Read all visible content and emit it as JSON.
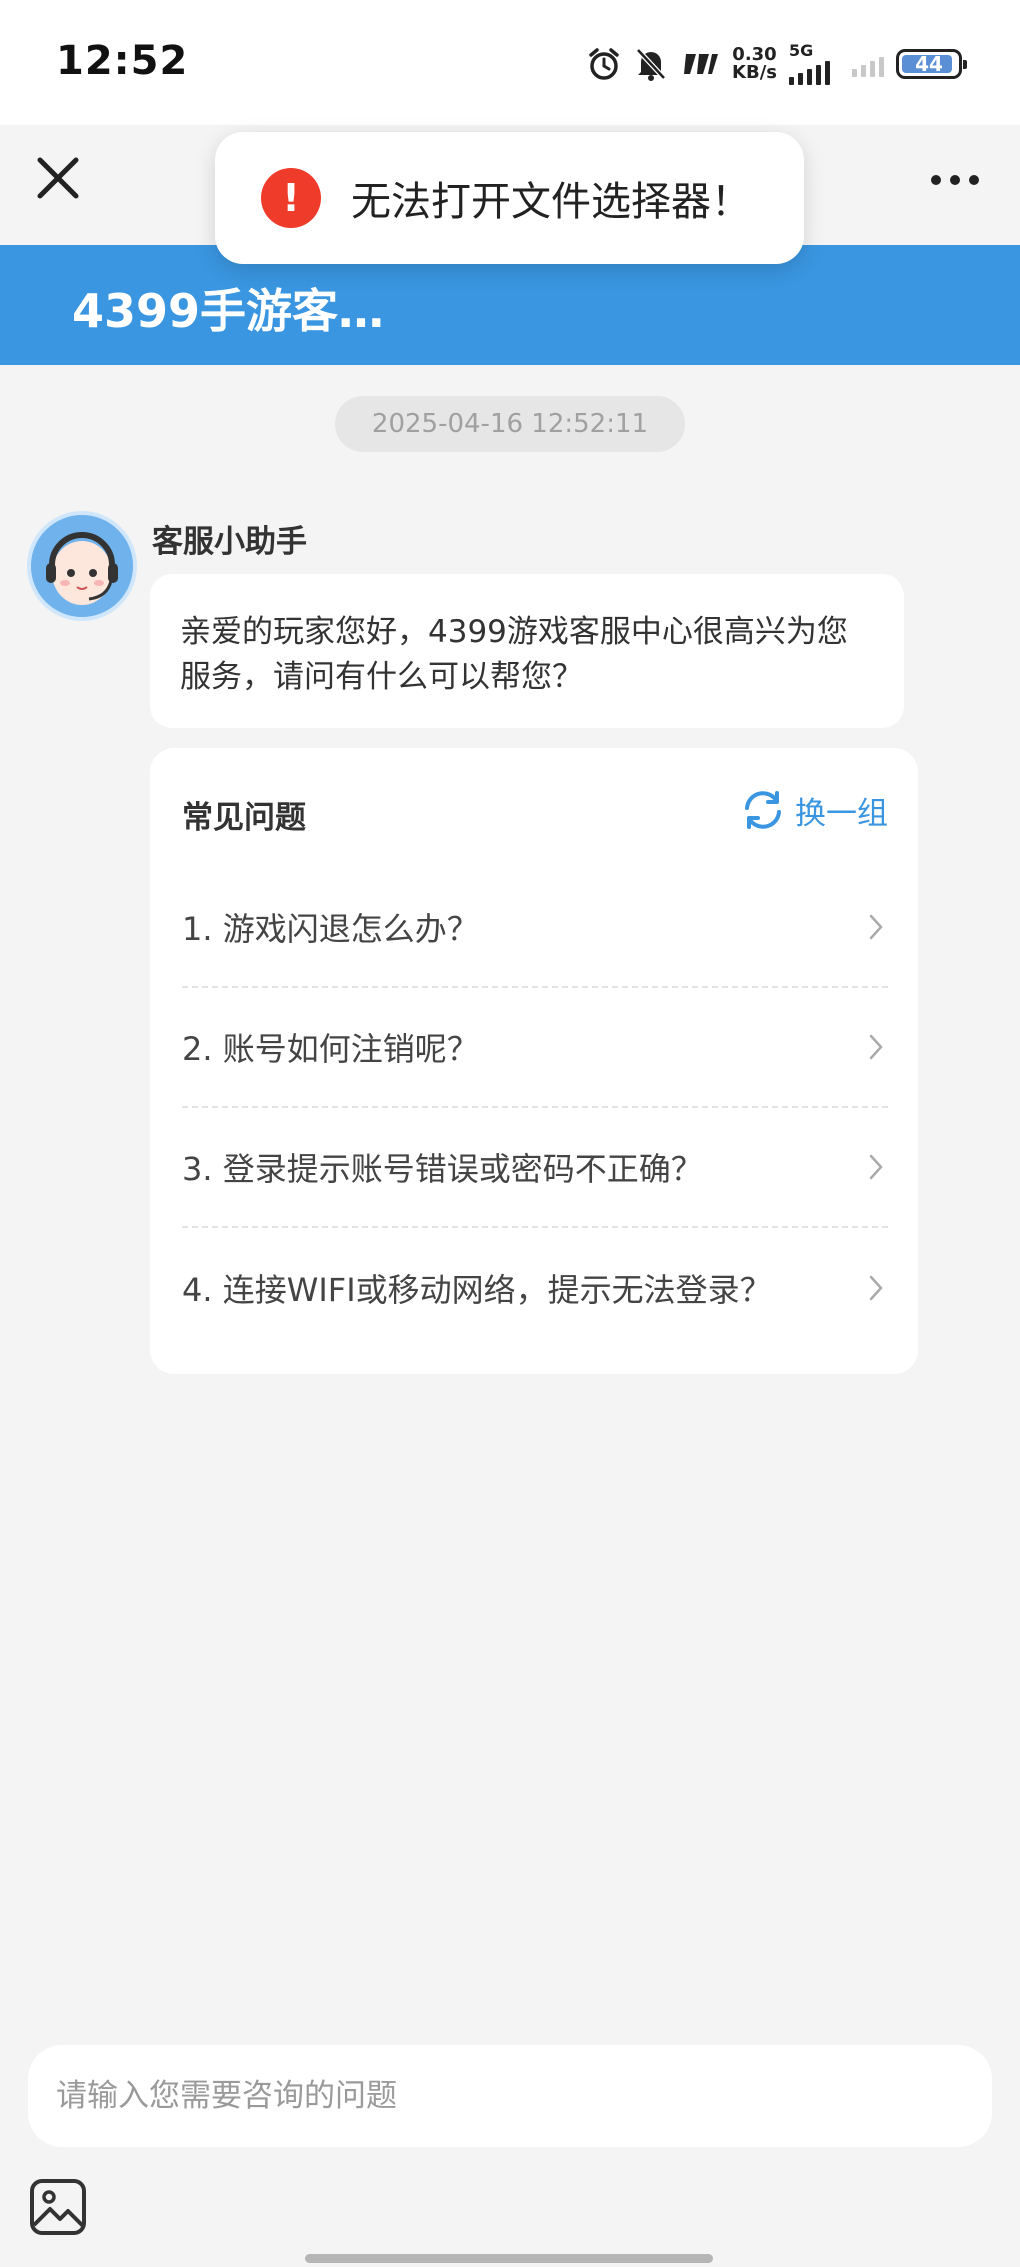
{
  "status_bar": {
    "time": "12:52",
    "net_speed_value": "0.30",
    "net_speed_unit": "KB/s",
    "network_type": "5G",
    "battery": "44",
    "icons": [
      "alarm-icon",
      "mute-icon",
      "speed-icon",
      "signal-5g-icon",
      "signal-icon",
      "battery-icon"
    ]
  },
  "nav": {
    "close_icon": "close-icon",
    "more_icon": "more-icon"
  },
  "header": {
    "title": "4399手游客…",
    "color": "#3a96e0"
  },
  "toast": {
    "icon": "exclamation",
    "message": "无法打开文件选择器！",
    "icon_color": "#ee3b2a"
  },
  "chat": {
    "timestamp": "2025-04-16 12:52:11",
    "agent_name": "客服小助手",
    "greeting": "亲爱的玩家您好，4399游戏客服中心很高兴为您服务，请问有什么可以帮您？"
  },
  "faq": {
    "title": "常见问题",
    "refresh_label": "换一组",
    "items": [
      {
        "label": "1. 游戏闪退怎么办？"
      },
      {
        "label": "2. 账号如何注销呢？"
      },
      {
        "label": "3. 登录提示账号错误或密码不正确？"
      },
      {
        "label": "4. 连接WIFI或移动网络，提示无法登录？"
      }
    ]
  },
  "input": {
    "placeholder": "请输入您需要咨询的问题",
    "value": ""
  },
  "accent_color": "#3a96e0"
}
